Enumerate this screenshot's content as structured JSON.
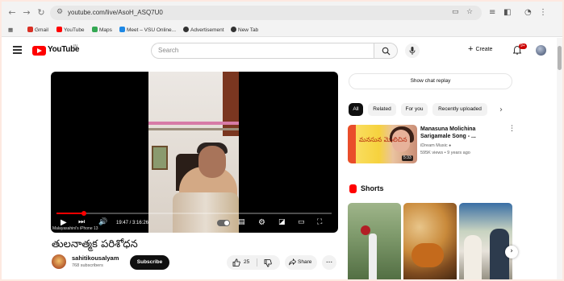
{
  "browser": {
    "url": "youtube.com/live/AsoH_ASQ7U0",
    "bookmarks": [
      {
        "label": "Gmail",
        "color": "#d93025"
      },
      {
        "label": "YouTube",
        "color": "#ff0000"
      },
      {
        "label": "Maps",
        "color": "#34a853"
      },
      {
        "label": "Meet – VSU Online...",
        "color": "#1e88e5"
      },
      {
        "label": "Advertisement",
        "color": "#333333"
      },
      {
        "label": "New Tab",
        "color": "#333333"
      }
    ]
  },
  "header": {
    "logo_text": "YouTube",
    "country_code": "IN",
    "search_placeholder": "Search",
    "create_label": "Create",
    "notification_count": "9+"
  },
  "player": {
    "current_time": "19:47",
    "duration": "3:16:26",
    "progress_fraction": 0.1,
    "caption": "Malayasahini's iPhone 13"
  },
  "video": {
    "title": "తులనాత్మక పరిశోధన",
    "channel": "sahitikousalyam",
    "subscribers": "768 subscribers",
    "subscribe_label": "Subscribe",
    "likes": "25",
    "share_label": "Share",
    "more_label": "..."
  },
  "sidebar": {
    "chat_replay_label": "Show chat replay",
    "chips": [
      "All",
      "Related",
      "For you",
      "Recently uploaded"
    ],
    "recommended": {
      "title": "Manasuna Molichina Sarigamale Song - ...",
      "channel": "iDream Music",
      "meta": "595K views • 9 years ago",
      "duration": "5:33",
      "thumb_text": "మనసున మొలిచిన"
    },
    "shorts_label": "Shorts"
  }
}
